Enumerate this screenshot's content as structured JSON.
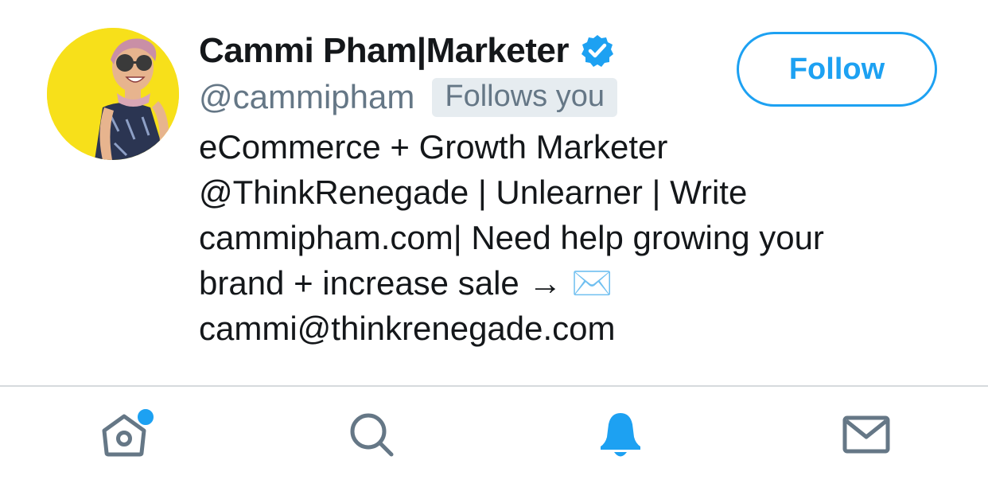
{
  "profile": {
    "display_name": "Cammi Pham|Marketer",
    "handle": "@cammipham",
    "follows_you_badge": "Follows you",
    "verified": true,
    "bio_lines": [
      "eCommerce + Growth Marketer",
      "@ThinkRenegade | Unlearner | Write",
      "cammipham.com| Need help growing your",
      "brand + increase sale →",
      "cammi@thinkrenegade.com"
    ],
    "bio_emoji": "✉️"
  },
  "actions": {
    "follow_label": "Follow"
  },
  "tab_bar": {
    "items": [
      {
        "name": "home",
        "icon": "home-icon",
        "active": false,
        "has_badge": true
      },
      {
        "name": "search",
        "icon": "search-icon",
        "active": false,
        "has_badge": false
      },
      {
        "name": "notifications",
        "icon": "bell-icon",
        "active": true,
        "has_badge": false
      },
      {
        "name": "messages",
        "icon": "envelope-icon",
        "active": false,
        "has_badge": false
      }
    ]
  },
  "colors": {
    "accent": "#1da1f2",
    "secondary_text": "#657786",
    "badge_bg": "#e6ecf0",
    "avatar_bg": "#f7e01a",
    "inactive_icon": "#657786"
  }
}
